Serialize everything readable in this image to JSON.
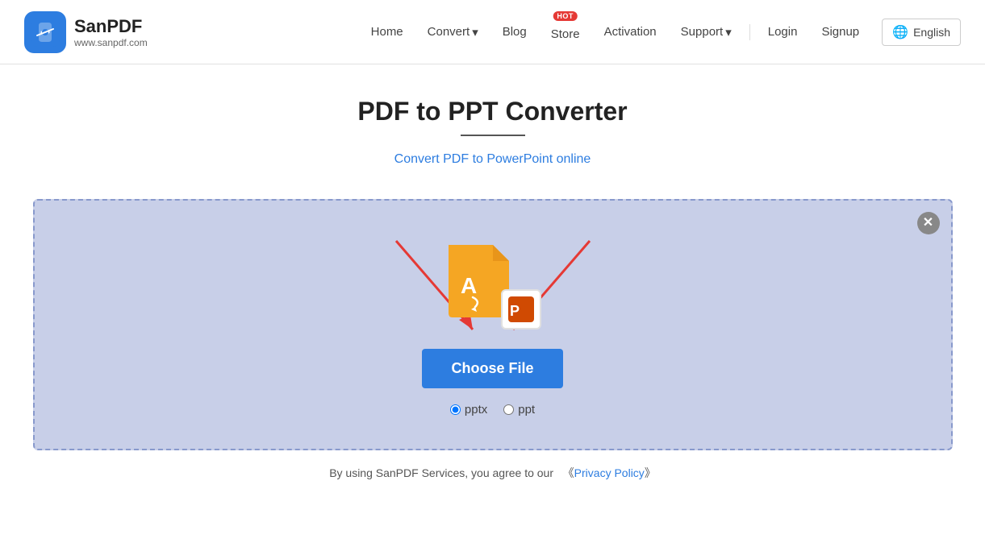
{
  "logo": {
    "name": "SanPDF",
    "url": "www.sanpdf.com"
  },
  "nav": {
    "home": "Home",
    "convert": "Convert",
    "convert_arrow": "▾",
    "blog": "Blog",
    "store": "Store",
    "store_badge": "HOT",
    "activation": "Activation",
    "support": "Support",
    "support_arrow": "▾",
    "login": "Login",
    "signup": "Signup",
    "language": "English"
  },
  "page": {
    "title": "PDF to PPT Converter",
    "subtitle": "Convert PDF to PowerPoint online"
  },
  "upload": {
    "choose_file": "Choose File",
    "close_icon": "✕",
    "radio_pptx": "pptx",
    "radio_ppt": "ppt"
  },
  "footer_note": {
    "text_before": "By using SanPDF Services, you agree to our",
    "link_open": "《",
    "link_text": "Privacy Policy",
    "link_close": "》"
  }
}
